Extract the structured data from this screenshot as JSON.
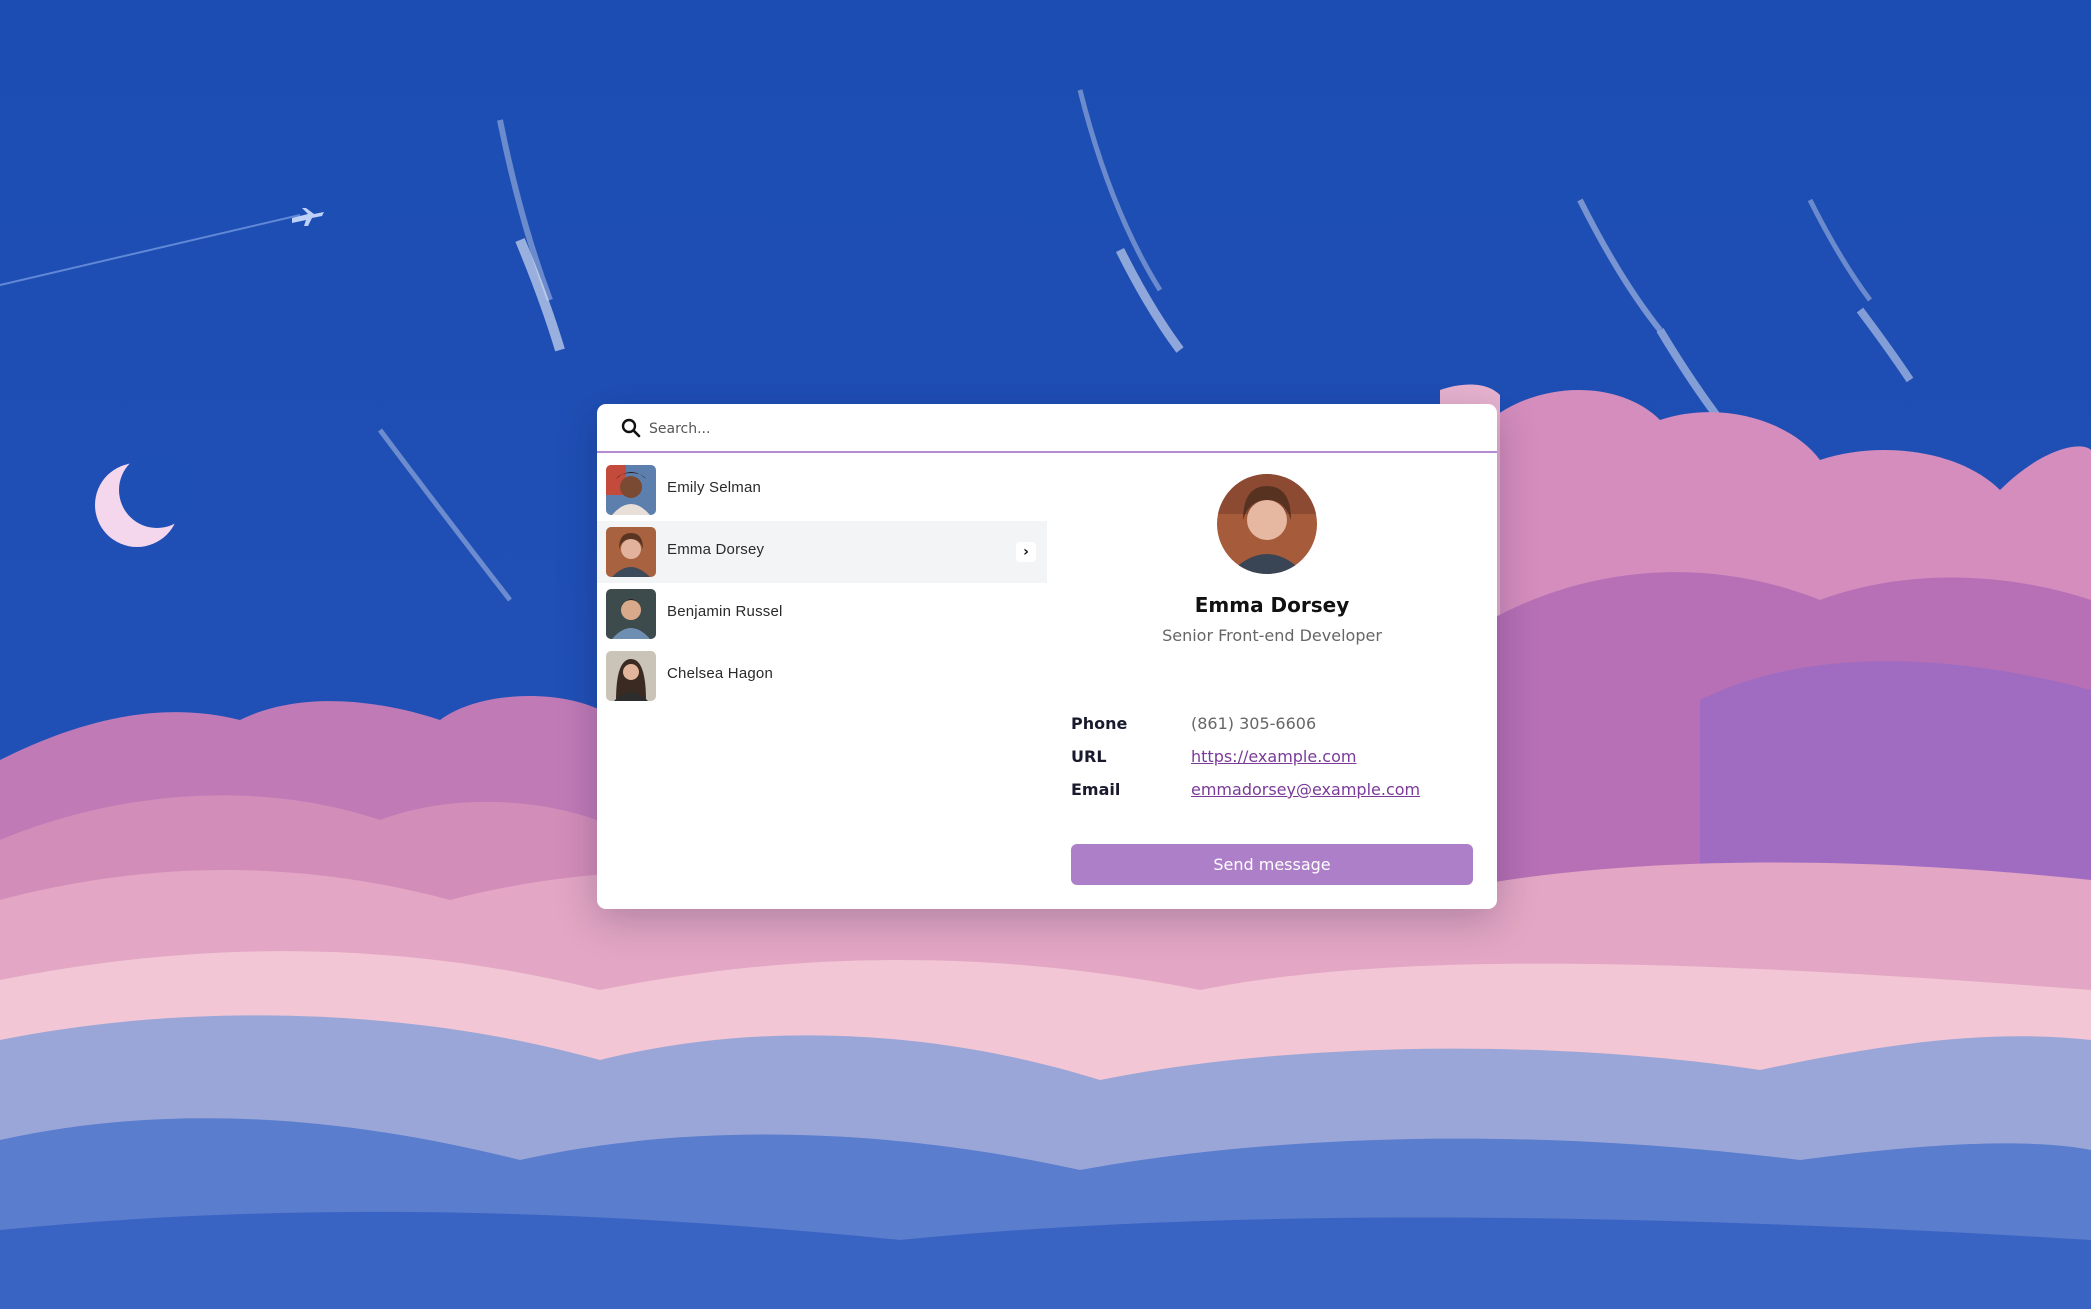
{
  "search": {
    "placeholder": "Search..."
  },
  "contacts": [
    {
      "name": "Emily Selman",
      "selected": false
    },
    {
      "name": "Emma Dorsey",
      "selected": true
    },
    {
      "name": "Benjamin Russel",
      "selected": false
    },
    {
      "name": "Chelsea Hagon",
      "selected": false
    }
  ],
  "selected_contact": {
    "name": "Emma Dorsey",
    "role": "Senior Front-end Developer",
    "details": [
      {
        "label": "Phone",
        "value": "(861) 305-6606"
      },
      {
        "label": "URL",
        "value": "https://example.com"
      },
      {
        "label": "Email",
        "value": "emmadorsey@example.com"
      }
    ],
    "action_label": "Send message"
  },
  "icons": {
    "search": "search-icon",
    "open": "chevron-right-icon"
  },
  "colors": {
    "accent": "#ad7fc9",
    "link": "#7a3a98",
    "divider": "#b58bd0",
    "selected_row": "#f3f4f6"
  }
}
